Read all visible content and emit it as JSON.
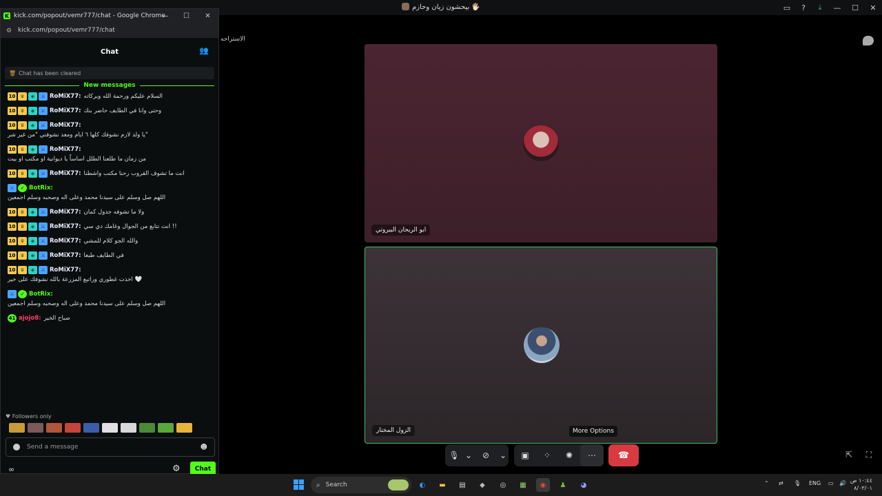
{
  "top_bar": {
    "title": "بيحشون زيان وحازم 🖐🏻",
    "icons": [
      "inbox-icon",
      "help-icon",
      "download-icon"
    ],
    "window_controls": [
      "—",
      "☐",
      "✕"
    ]
  },
  "stage": {
    "side_label": "الاستراحه",
    "participants": [
      {
        "name": "ابو الريحان البيروتي"
      },
      {
        "name": "الزول المختار"
      }
    ],
    "tooltip": "More Options"
  },
  "popout": {
    "window_title": "kick.com/popout/vemr777/chat - Google Chrome",
    "url": "kick.com/popout/vemr777/chat",
    "chat_title": "Chat",
    "cleared_notice": "Chat has been cleared",
    "new_messages_label": "New messages",
    "messages": [
      {
        "badges": [
          "10",
          "crown",
          "vip",
          "mod"
        ],
        "user": "RoMiX77:",
        "user_class": "u-romix",
        "text": "السلام عليكم ورحمة الله وبركاته"
      },
      {
        "badges": [
          "10",
          "crown",
          "vip",
          "mod"
        ],
        "user": "RoMiX77:",
        "user_class": "u-romix",
        "text": "وحتى وانا في الطايف حاضر بنك"
      },
      {
        "badges": [
          "10",
          "crown",
          "vip",
          "mod"
        ],
        "user": "RoMiX77:",
        "user_class": "u-romix",
        "text": "يا ولد لازم نشوفك كلها ٦ ايام ومعد نشوفني \"من غير شر\""
      },
      {
        "badges": [
          "10",
          "crown",
          "vip",
          "mod"
        ],
        "user": "RoMiX77:",
        "user_class": "u-romix",
        "text": "من زمان ما طلعنا الطلل اساساً يا ديوانية او مكتب او بيت"
      },
      {
        "badges": [
          "10",
          "crown",
          "vip",
          "mod"
        ],
        "user": "RoMiX77:",
        "user_class": "u-romix",
        "text": "انت ما تشوف القروب رحنا مكتب واشطنا"
      },
      {
        "badges": [
          "mod",
          "verified"
        ],
        "user": "BotRix:",
        "user_class": "u-botrix",
        "text": "اللهم صل وسلم على سيدنا محمد وعلى اله وصحبه وسلم اجمعين"
      },
      {
        "badges": [
          "10",
          "crown",
          "vip",
          "mod"
        ],
        "user": "RoMiX77:",
        "user_class": "u-romix",
        "text": "ولا ما تشوفه جدول كمان"
      },
      {
        "badges": [
          "10",
          "crown",
          "vip",
          "mod"
        ],
        "user": "RoMiX77:",
        "user_class": "u-romix",
        "text": "انت تتابع من الجوال وغامك دي سي !!"
      },
      {
        "badges": [
          "10",
          "crown",
          "vip",
          "mod"
        ],
        "user": "RoMiX77:",
        "user_class": "u-romix",
        "text": "والله الجو كلام للمشي"
      },
      {
        "badges": [
          "10",
          "crown",
          "vip",
          "mod"
        ],
        "user": "RoMiX77:",
        "user_class": "u-romix",
        "text": "في الطايف طبعا"
      },
      {
        "badges": [
          "10",
          "crown",
          "vip",
          "mod"
        ],
        "user": "RoMiX77:",
        "user_class": "u-romix",
        "text": "اخذت غطوري وراتبع المزرعة بالله نشوفك على خير 🤍"
      },
      {
        "badges": [
          "mod",
          "verified"
        ],
        "user": "BotRix:",
        "user_class": "u-botrix",
        "text": "اللهم صل وسلم على سيدنا محمد وعلى اله وصحبه وسلم اجمعين"
      },
      {
        "badges": [
          "41"
        ],
        "user": "ajojo8:",
        "user_class": "u-ajojo",
        "text": "صباح الخير"
      }
    ],
    "followers_only": "Followers only",
    "emote_colors": [
      "#c89a3a",
      "#7a5a5a",
      "#b0563a",
      "#c4453a",
      "#3a5fa8",
      "#e0e0e0",
      "#d8d8d8",
      "#4a8a3a",
      "#5aa83a",
      "#e8b33a"
    ],
    "send_placeholder": "Send a message",
    "chat_button": "Chat"
  },
  "taskbar": {
    "search_label": "Search",
    "lang": "ENG",
    "time": "١٠:٤٤ ص",
    "date": "٨/٠٣/٠١"
  }
}
